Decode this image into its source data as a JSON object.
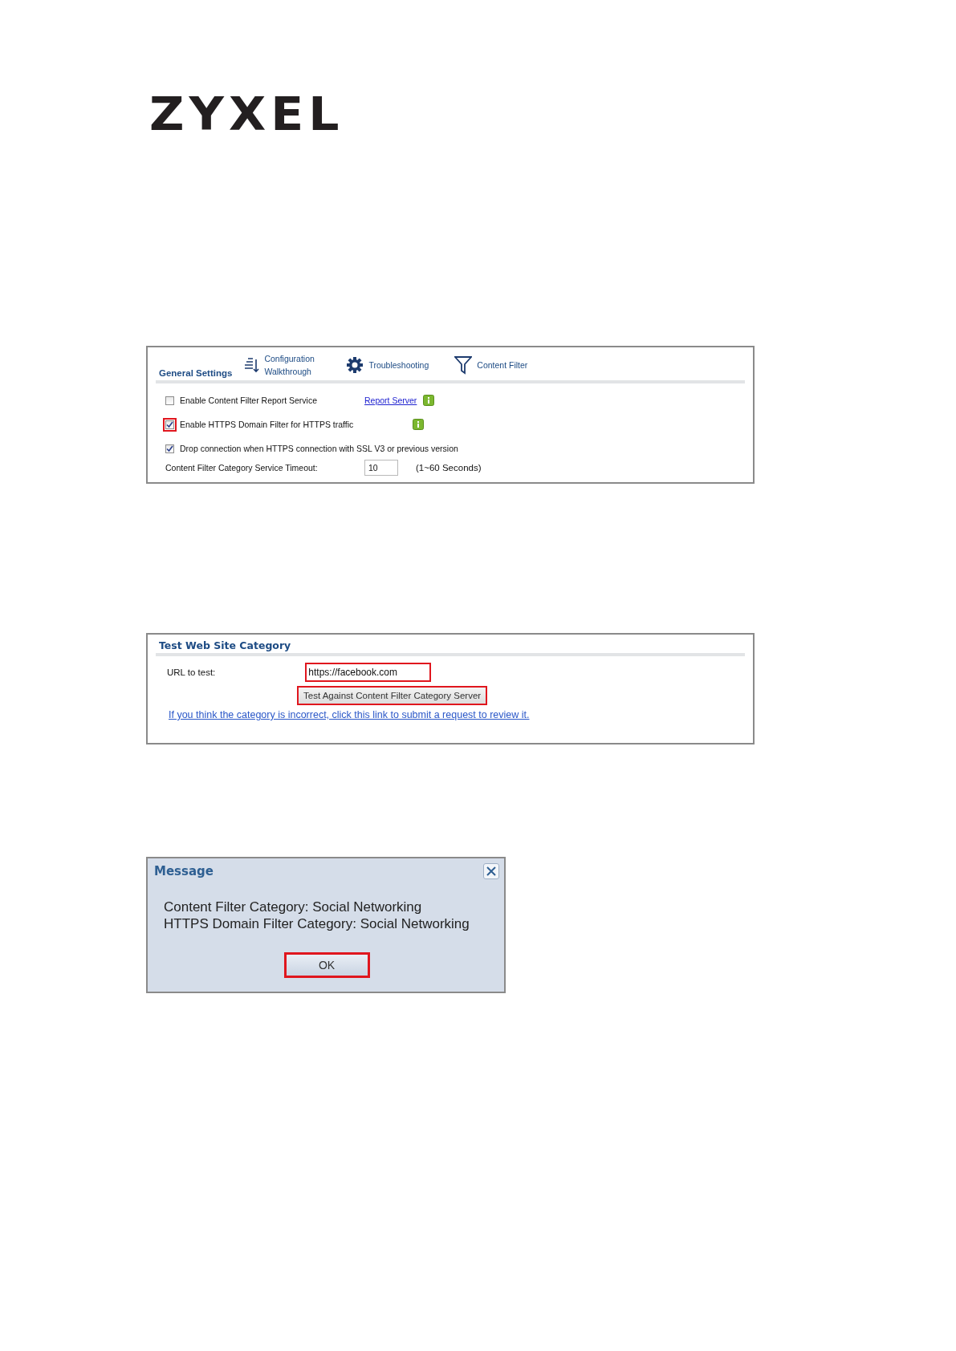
{
  "logo": {
    "text": "ZYXEL"
  },
  "general_settings": {
    "title": "General Settings",
    "tabs": [
      {
        "kind": "walkthrough",
        "label": "Configuration Walkthrough"
      },
      {
        "kind": "troubleshooting",
        "label": "Troubleshooting"
      },
      {
        "kind": "filter",
        "label": "Content Filter"
      }
    ],
    "options": [
      {
        "kind": "checkbox",
        "label": "Enable Content Filter Report Service",
        "checked": false,
        "highlighted": false,
        "link": "Report Server",
        "info": true
      },
      {
        "kind": "checkbox",
        "label": "Enable HTTPS Domain Filter for HTTPS traffic",
        "checked": true,
        "highlighted": true,
        "info": true
      },
      {
        "kind": "checkbox",
        "label": "Drop connection when HTTPS connection with SSL V3 or previous version",
        "checked": true,
        "highlighted": false,
        "info": false
      },
      {
        "kind": "field",
        "label": "Content Filter Category Service Timeout:",
        "value": "10",
        "hint": "(1~60 Seconds)"
      }
    ]
  },
  "test_category": {
    "title": "Test Web Site Category",
    "url_label": "URL to test:",
    "url_value": "https://facebook.com",
    "url_highlighted": true,
    "button": {
      "label": "Test Against Content Filter Category Server",
      "highlighted": true
    },
    "link": "If you think the category is incorrect, click this link to submit a request to review it."
  },
  "message": {
    "title": "Message",
    "lines": [
      "Content Filter Category: Social Networking",
      "HTTPS Domain Filter Category: Social Networking"
    ],
    "button": {
      "label": "OK",
      "highlighted": true
    }
  }
}
